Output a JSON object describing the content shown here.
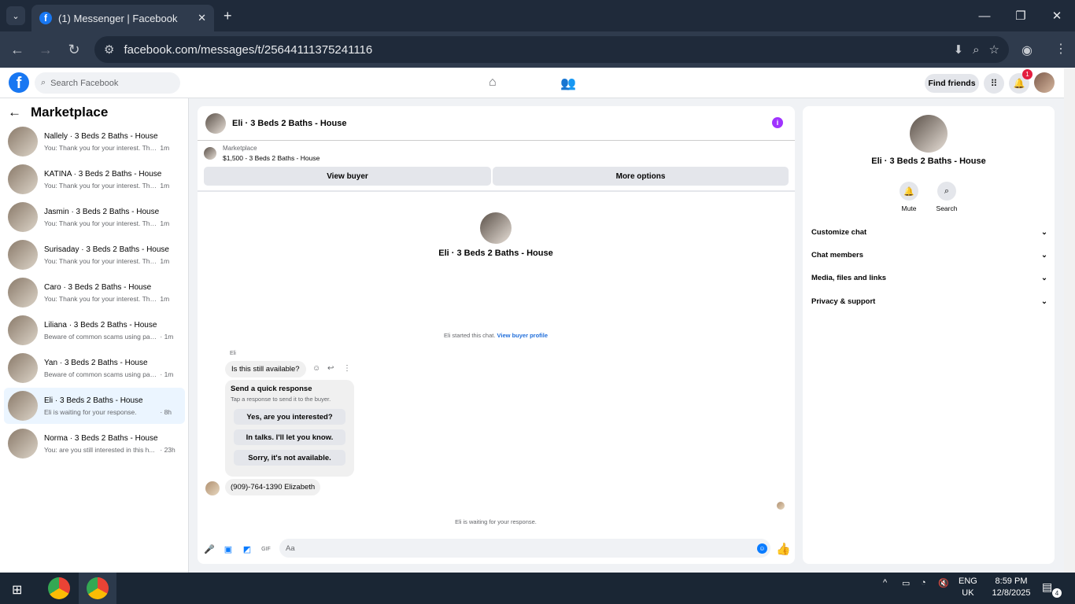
{
  "browser": {
    "tab_title": "(1) Messenger | Facebook",
    "url": "facebook.com/messages/t/25644111375241116"
  },
  "fb_header": {
    "search_placeholder": "Search Facebook",
    "find_friends": "Find friends",
    "notification_count": "1"
  },
  "sidebar": {
    "title": "Marketplace",
    "conversations": [
      {
        "name": "Nallely · 3 Beds 2 Baths - House",
        "preview": "You: Thank you for your interest. The ...",
        "time": "1m"
      },
      {
        "name": "KATINA · 3 Beds 2 Baths - House",
        "preview": "You: Thank you for your interest. The ...",
        "time": "1m"
      },
      {
        "name": "Jasmin · 3 Beds 2 Baths - House",
        "preview": "You: Thank you for your interest. The ...",
        "time": "1m"
      },
      {
        "name": "Surisaday · 3 Beds 2 Baths - House",
        "preview": "You: Thank you for your interest. The ...",
        "time": "1m"
      },
      {
        "name": "Caro · 3 Beds 2 Baths - House",
        "preview": "You: Thank you for your interest. The ...",
        "time": "1m"
      },
      {
        "name": "Liliana · 3 Beds 2 Baths - House",
        "preview": "Beware of common scams using pay...",
        "time": "· 1m"
      },
      {
        "name": "Yan · 3 Beds 2 Baths - House",
        "preview": "Beware of common scams using pay...",
        "time": "· 1m"
      },
      {
        "name": "Eli · 3 Beds 2 Baths - House",
        "preview": "Eli is waiting for your response.",
        "time": "· 8h"
      },
      {
        "name": "Norma · 3 Beds 2 Baths - House",
        "preview": "You: are you still interested in this h...",
        "time": "· 23h"
      }
    ]
  },
  "chat": {
    "title": "Eli · 3 Beds 2 Baths - House",
    "marketplace_label": "Marketplace",
    "listing": "$1,500 - 3 Beds 2 Baths - House",
    "view_buyer": "View buyer",
    "more_options": "More options",
    "center_name": "Eli · 3 Beds 2 Baths - House",
    "started_note": "Eli started this chat.",
    "view_buyer_profile": "View buyer profile",
    "sender_label": "Eli",
    "message1": "Is this still available?",
    "quick_title": "Send a quick response",
    "quick_sub": "Tap a response to send it to the buyer.",
    "quick_responses": [
      "Yes, are you interested?",
      "In talks. I'll let you know.",
      "Sorry, it's not available."
    ],
    "message2": "(909)-764-1390 Elizabeth",
    "waiting_note": "Eli is waiting for your response.",
    "composer_placeholder": "Aa"
  },
  "details": {
    "name": "Eli · 3 Beds 2 Baths - House",
    "mute": "Mute",
    "search": "Search",
    "sections": [
      "Customize chat",
      "Chat members",
      "Media, files and links",
      "Privacy & support"
    ]
  },
  "taskbar": {
    "lang1": "ENG",
    "lang2": "UK",
    "time": "8:59 PM",
    "date": "12/8/2025",
    "notif_count": "4"
  }
}
